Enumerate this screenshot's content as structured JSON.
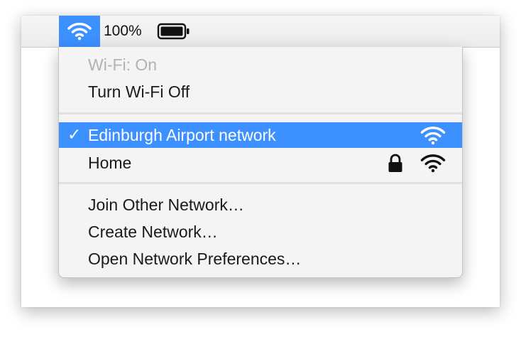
{
  "menubar": {
    "wifi_icon": "wifi-icon",
    "battery_percent": "100%",
    "battery_icon": "battery-icon"
  },
  "menu": {
    "status": "Wi-Fi: On",
    "toggle": "Turn Wi-Fi Off",
    "networks": [
      {
        "name": "Edinburgh Airport network",
        "selected": true,
        "locked": false,
        "check": "✓"
      },
      {
        "name": "Home",
        "selected": false,
        "locked": true
      }
    ],
    "actions": [
      "Join Other Network…",
      "Create Network…",
      "Open Network Preferences…"
    ]
  },
  "colors": {
    "accent": "#3d90ff",
    "menu_bg": "#f4f4f4",
    "text": "#1a1a1a",
    "disabled_text": "#b2b2b2"
  }
}
